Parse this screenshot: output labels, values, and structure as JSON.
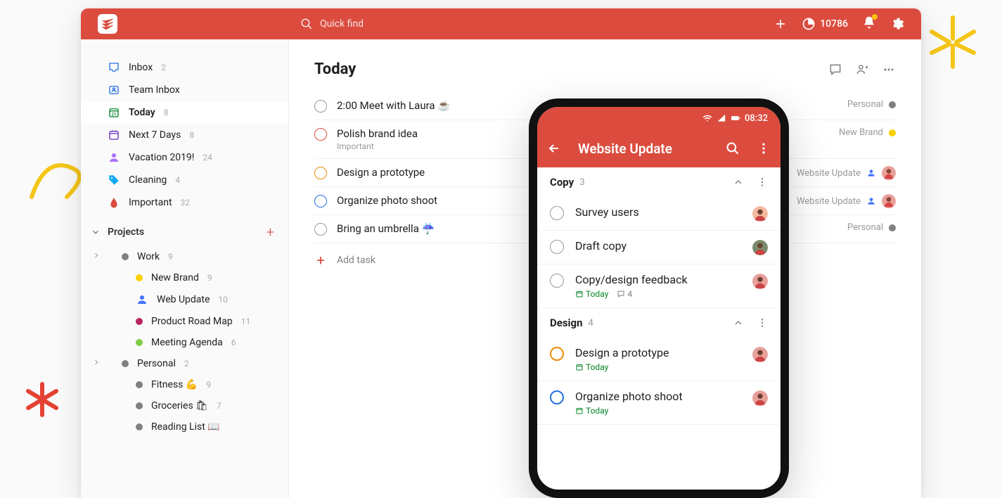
{
  "topbar": {
    "search_placeholder": "Quick find",
    "karma_count": "10786"
  },
  "sidebar": {
    "items": [
      {
        "label": "Inbox",
        "count": "2"
      },
      {
        "label": "Team Inbox",
        "count": ""
      },
      {
        "label": "Today",
        "count": "8"
      },
      {
        "label": "Next 7 Days",
        "count": "8"
      },
      {
        "label": "Vacation 2019!",
        "count": "24"
      },
      {
        "label": "Cleaning",
        "count": "4"
      },
      {
        "label": "Important",
        "count": "32"
      }
    ],
    "projects_header": "Projects",
    "projects": [
      {
        "label": "Work",
        "count": "9",
        "color": "#808080",
        "nested": false,
        "expandable": true
      },
      {
        "label": "New Brand",
        "count": "9",
        "color": "#fad000",
        "nested": true
      },
      {
        "label": "Web Update",
        "count": "10",
        "color": "#4073ff",
        "nested": true,
        "person": true
      },
      {
        "label": "Product Road Map",
        "count": "11",
        "color": "#b8255f",
        "nested": true
      },
      {
        "label": "Meeting Agenda",
        "count": "6",
        "color": "#7ecc49",
        "nested": true
      },
      {
        "label": "Personal",
        "count": "2",
        "color": "#808080",
        "nested": false,
        "expandable": true
      },
      {
        "label": "Fitness 💪",
        "count": "9",
        "color": "#808080",
        "nested": true
      },
      {
        "label": "Groceries 🛍",
        "count": "7",
        "color": "#808080",
        "nested": true
      },
      {
        "label": "Reading List 📖",
        "count": "",
        "color": "#808080",
        "nested": true
      }
    ]
  },
  "main": {
    "title": "Today",
    "tasks": [
      {
        "title": "2:00 Meet with Laura ☕",
        "label": "",
        "priority": "",
        "project": "Personal",
        "proj_color": "#808080"
      },
      {
        "title": "Polish brand idea",
        "label": "Important",
        "priority": "p1",
        "project": "New Brand",
        "proj_color": "#fad000"
      },
      {
        "title": "Design a prototype",
        "label": "",
        "priority": "p2",
        "project": "Website Update",
        "avatar": true
      },
      {
        "title": "Organize photo shoot",
        "label": "",
        "priority": "p3",
        "project": "Website Update",
        "avatar": true
      },
      {
        "title": "Bring an umbrella ☔",
        "label": "",
        "priority": "",
        "project": "Personal",
        "proj_color": "#808080"
      }
    ],
    "add_task": "Add task"
  },
  "phone": {
    "time": "08:32",
    "header_title": "Website Update",
    "sections": [
      {
        "name": "Copy",
        "count": "3",
        "tasks": [
          {
            "title": "Survey users",
            "avatar_bg": "#f4b89f"
          },
          {
            "title": "Draft copy",
            "avatar_bg": "#7a8c6d"
          },
          {
            "title": "Copy/design feedback",
            "due": "Today",
            "comments": "4",
            "avatar_bg": "#e8a09a"
          }
        ]
      },
      {
        "name": "Design",
        "count": "4",
        "tasks": [
          {
            "title": "Design a prototype",
            "priority": "p2",
            "due": "Today",
            "avatar_bg": "#e8a09a"
          },
          {
            "title": "Organize photo shoot",
            "priority": "p3",
            "due": "Today",
            "avatar_bg": "#e8a09a"
          }
        ]
      }
    ]
  }
}
